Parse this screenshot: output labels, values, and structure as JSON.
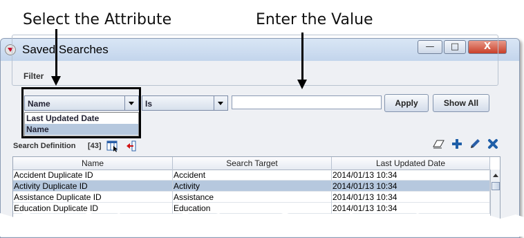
{
  "annotations": {
    "select_attribute": "Select the Attribute",
    "enter_value": "Enter the Value"
  },
  "window": {
    "title": "Saved Searches",
    "controls": {
      "minimize": "—",
      "maximize": "□",
      "close": "X"
    }
  },
  "filter": {
    "group_label": "Filter",
    "attribute_combo": {
      "selected": "Name",
      "options": [
        "Last Updated Date",
        "Name"
      ]
    },
    "operator_combo": {
      "selected": "Is"
    },
    "value_input": {
      "value": "",
      "placeholder": ""
    },
    "apply_label": "Apply",
    "show_all_label": "Show All"
  },
  "search_definition": {
    "label": "Search Definition",
    "count": "[43]",
    "toolbar_icons": [
      "columns-icon",
      "export-icon",
      "eraser-icon",
      "add-icon",
      "edit-icon",
      "delete-icon"
    ]
  },
  "table": {
    "columns": [
      "Name",
      "Search Target",
      "Last Updated Date"
    ],
    "rows": [
      [
        "Accident Duplicate ID",
        "Accident",
        "2014/01/13 10:34"
      ],
      [
        "Activity Duplicate ID",
        "Activity",
        "2014/01/13 10:34"
      ],
      [
        "Assistance Duplicate ID",
        "Assistance",
        "2014/01/13 10:34"
      ],
      [
        "Education Duplicate ID",
        "Education",
        "2014/01/13 10:34"
      ]
    ],
    "selected_row": 1
  },
  "colors": {
    "selection": "#b6c8de",
    "close_button": "#c9402a",
    "arrow": "#000000"
  }
}
